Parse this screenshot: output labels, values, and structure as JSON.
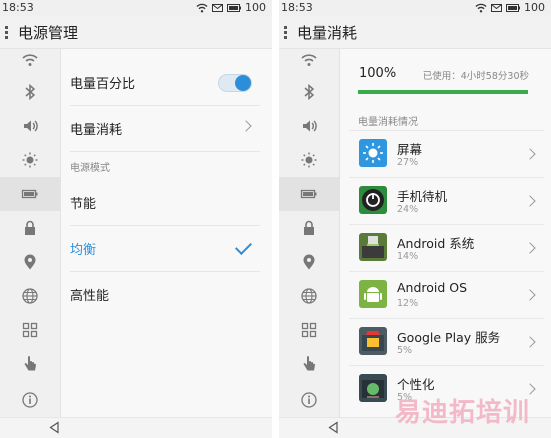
{
  "left": {
    "status": {
      "time": "18:53",
      "battery": "100"
    },
    "title": "电源管理",
    "rows": {
      "battery_percent": "电量百分比",
      "power_usage": "电量消耗",
      "power_mode_header": "电源模式",
      "mode_saving": "节能",
      "mode_balanced": "均衡",
      "mode_performance": "高性能"
    },
    "toggle_on": true,
    "selected_mode": "均衡"
  },
  "right": {
    "status": {
      "time": "18:53",
      "battery": "100"
    },
    "title": "电量消耗",
    "battery_level": "100%",
    "battery_fraction": 1.0,
    "used_time": "已使用：4小时58分30秒",
    "usage_header": "电量消耗情况",
    "apps": [
      {
        "name": "屏幕",
        "percent": "27%",
        "icon": "screen-brightness-icon",
        "color": "#2f96e0"
      },
      {
        "name": "手机待机",
        "percent": "24%",
        "icon": "phone-standby-icon",
        "color": "#2e8a3c"
      },
      {
        "name": "Android 系统",
        "percent": "14%",
        "icon": "android-system-icon",
        "color": "#5a7a3a"
      },
      {
        "name": "Android OS",
        "percent": "12%",
        "icon": "android-os-icon",
        "color": "#7cb342"
      },
      {
        "name": "Google Play 服务",
        "percent": "5%",
        "icon": "google-play-services-icon",
        "color": "#4e5b63"
      },
      {
        "name": "个性化",
        "percent": "5%",
        "icon": "personalization-icon",
        "color": "#3a4a52"
      }
    ]
  },
  "rail_icons": [
    "wifi-icon",
    "bluetooth-icon",
    "sound-icon",
    "brightness-icon",
    "battery-icon",
    "lock-icon",
    "location-icon",
    "globe-icon",
    "apps-grid-icon",
    "hand-gesture-icon",
    "info-icon"
  ],
  "watermark": "易迪拓培训",
  "colors": {
    "accent": "#2a8fd8",
    "battery_bar": "#3aab4a"
  }
}
